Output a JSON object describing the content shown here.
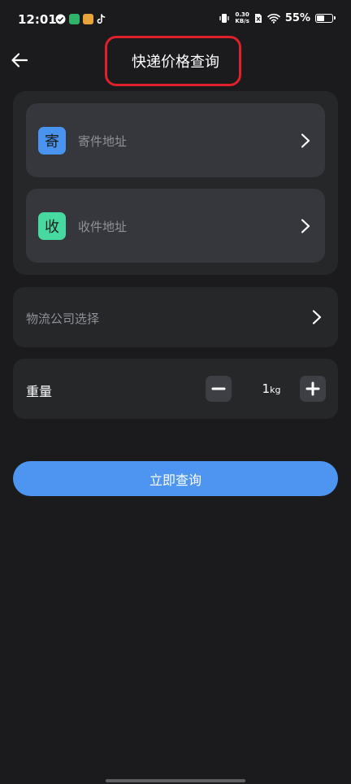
{
  "status_bar": {
    "time": "12:01",
    "net_speed_value": "0.30",
    "net_speed_unit": "KB/s",
    "battery_percent": "55%",
    "battery_level": 0.55,
    "app_icons": [
      "check-circle-icon",
      "map-app-icon",
      "weibo-icon",
      "tiktok-icon"
    ],
    "right_icons": [
      "vibrate-icon",
      "no-sim-icon",
      "wifi-icon",
      "battery-icon"
    ]
  },
  "header": {
    "title": "快递价格查询",
    "back_icon": "back-arrow-icon",
    "highlight_color": "#e0202a"
  },
  "address": {
    "sender": {
      "badge": "寄",
      "label": "寄件地址",
      "badge_color": "#4a94f1"
    },
    "receiver": {
      "badge": "收",
      "label": "收件地址",
      "badge_color": "#46d9a0"
    }
  },
  "logistics": {
    "label": "物流公司选择"
  },
  "weight": {
    "label": "重量",
    "value": "1",
    "unit": "kg"
  },
  "query_button": {
    "label": "立即查询",
    "color": "#4e95f1"
  }
}
